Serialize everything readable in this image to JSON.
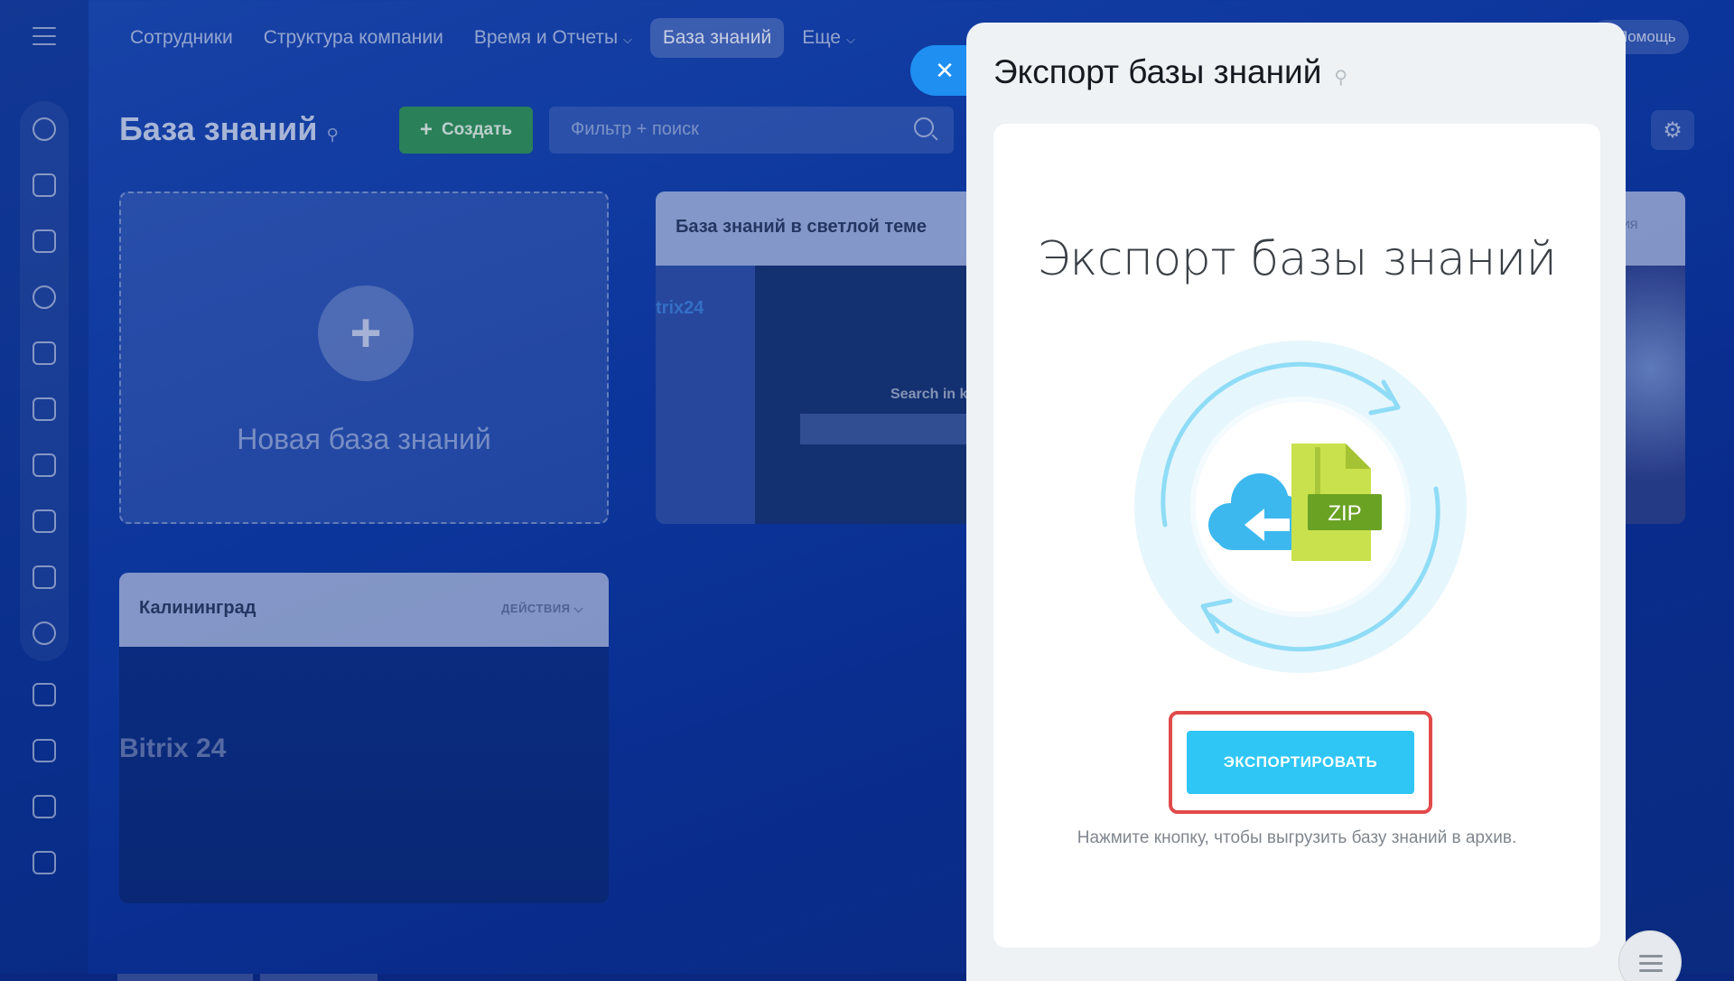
{
  "topnav": {
    "items": [
      {
        "label": "Сотрудники"
      },
      {
        "label": "Структура компании"
      },
      {
        "label": "Время и Отчеты"
      },
      {
        "label": "База знаний"
      },
      {
        "label": "Еще"
      }
    ],
    "help_label": "Помощь"
  },
  "page": {
    "title": "База знаний",
    "create_label": "Создать",
    "search_placeholder": "Фильтр + поиск"
  },
  "cards": {
    "new_kb_label": "Новая база знаний",
    "light_title": "База знаний в светлой теме",
    "light_brand": "trix24",
    "light_search_text": "Search in k",
    "kal_title": "Калининград",
    "kal_actions": "ДЕЙСТВИЯ",
    "kal_brand": "Bitrix 24",
    "right_actions": "ИЯ"
  },
  "slider": {
    "title": "Экспорт базы знаний",
    "heading": "Экспорт базы знаний",
    "zip_label": "ZIP",
    "export_button": "ЭКСПОРТИРОВАТЬ",
    "hint": "Нажмите кнопку, чтобы выгрузить базу знаний в архив."
  },
  "colors": {
    "accent": "#2fc6f6",
    "close": "#1f8ff2",
    "highlight": "#e14a4a",
    "create": "#2f8f5a"
  }
}
